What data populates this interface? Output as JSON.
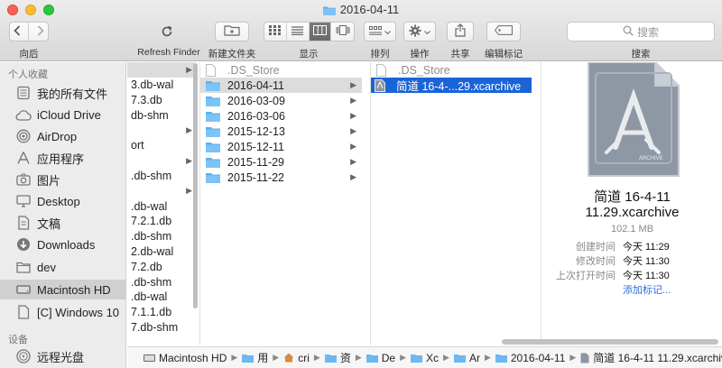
{
  "window": {
    "title": "2016-04-11"
  },
  "toolbar": {
    "back_label": "向后",
    "refresh_label": "Refresh Finder",
    "new_folder_label": "新建文件夹",
    "view_label": "显示",
    "arrange_label": "排列",
    "action_label": "操作",
    "share_label": "共享",
    "tags_label": "编辑标记",
    "search_label": "搜索",
    "search_placeholder": "搜索"
  },
  "sidebar": {
    "favorites_header": "个人收藏",
    "favorites": [
      {
        "label": "我的所有文件",
        "icon": "all-files-icon"
      },
      {
        "label": "iCloud Drive",
        "icon": "cloud-icon"
      },
      {
        "label": "AirDrop",
        "icon": "airdrop-icon"
      },
      {
        "label": "应用程序",
        "icon": "applications-icon"
      },
      {
        "label": "图片",
        "icon": "camera-icon"
      },
      {
        "label": "Desktop",
        "icon": "desktop-icon"
      },
      {
        "label": "文稿",
        "icon": "document-icon"
      },
      {
        "label": "Downloads",
        "icon": "downloads-icon"
      },
      {
        "label": "dev",
        "icon": "folder-icon"
      },
      {
        "label": "Macintosh HD",
        "icon": "harddisk-icon"
      },
      {
        "label": "[C] Windows 10",
        "icon": "harddisk-icon"
      }
    ],
    "devices_header": "设备",
    "devices": [
      {
        "label": "远程光盘",
        "icon": "disc-icon"
      }
    ]
  },
  "column1": {
    "items": [
      {
        "label": "",
        "arrow": true,
        "selected": true
      },
      {
        "label": "3.db-wal",
        "arrow": false
      },
      {
        "label": "7.3.db",
        "arrow": false
      },
      {
        "label": "db-shm",
        "arrow": false
      },
      {
        "label": "",
        "arrow": true
      },
      {
        "label": "ort",
        "arrow": false
      },
      {
        "label": "",
        "arrow": true
      },
      {
        "label": ".db-shm",
        "arrow": false
      },
      {
        "label": "",
        "arrow": true
      },
      {
        "label": ".db-wal",
        "arrow": false
      },
      {
        "label": "7.2.1.db",
        "arrow": false
      },
      {
        "label": ".db-shm",
        "arrow": false
      },
      {
        "label": "2.db-wal",
        "arrow": false
      },
      {
        "label": "7.2.db",
        "arrow": false
      },
      {
        "label": ".db-shm",
        "arrow": false
      },
      {
        "label": ".db-wal",
        "arrow": false
      },
      {
        "label": "7.1.1.db",
        "arrow": false
      },
      {
        "label": "7.db-shm",
        "arrow": false
      }
    ]
  },
  "column2": {
    "items": [
      {
        "label": ".DS_Store",
        "type": "file",
        "dim": true
      },
      {
        "label": "2016-04-11",
        "type": "folder",
        "selected": true
      },
      {
        "label": "2016-03-09",
        "type": "folder"
      },
      {
        "label": "2016-03-06",
        "type": "folder"
      },
      {
        "label": "2015-12-13",
        "type": "folder"
      },
      {
        "label": "2015-12-11",
        "type": "folder"
      },
      {
        "label": "2015-11-29",
        "type": "folder"
      },
      {
        "label": "2015-11-22",
        "type": "folder"
      }
    ]
  },
  "column3": {
    "items": [
      {
        "label": ".DS_Store",
        "type": "file",
        "dim": true
      },
      {
        "label": "简道 16-4-...29.xcarchive",
        "type": "archive",
        "selected": true
      }
    ]
  },
  "preview": {
    "icon_badge": "ARCHIVE",
    "name_line1": "简道 16-4-11",
    "name_line2": "11.29.xcarchive",
    "size": "102.1 MB",
    "created_label": "创建时间",
    "created_value": "今天 11:29",
    "modified_label": "修改时间",
    "modified_value": "今天 11:30",
    "opened_label": "上次打开时间",
    "opened_value": "今天 11:30",
    "add_tags": "添加标记..."
  },
  "pathbar": [
    {
      "label": "Macintosh HD",
      "icon": "harddisk-icon"
    },
    {
      "label": "用",
      "icon": "folder-icon"
    },
    {
      "label": "cri",
      "icon": "home-icon"
    },
    {
      "label": "资",
      "icon": "folder-icon"
    },
    {
      "label": "De",
      "icon": "folder-icon"
    },
    {
      "label": "Xc",
      "icon": "folder-icon"
    },
    {
      "label": "Ar",
      "icon": "folder-icon"
    },
    {
      "label": "2016-04-11",
      "icon": "folder-icon"
    },
    {
      "label": "简道 16-4-11 11.29.xcarchive",
      "icon": "archive-icon"
    }
  ]
}
